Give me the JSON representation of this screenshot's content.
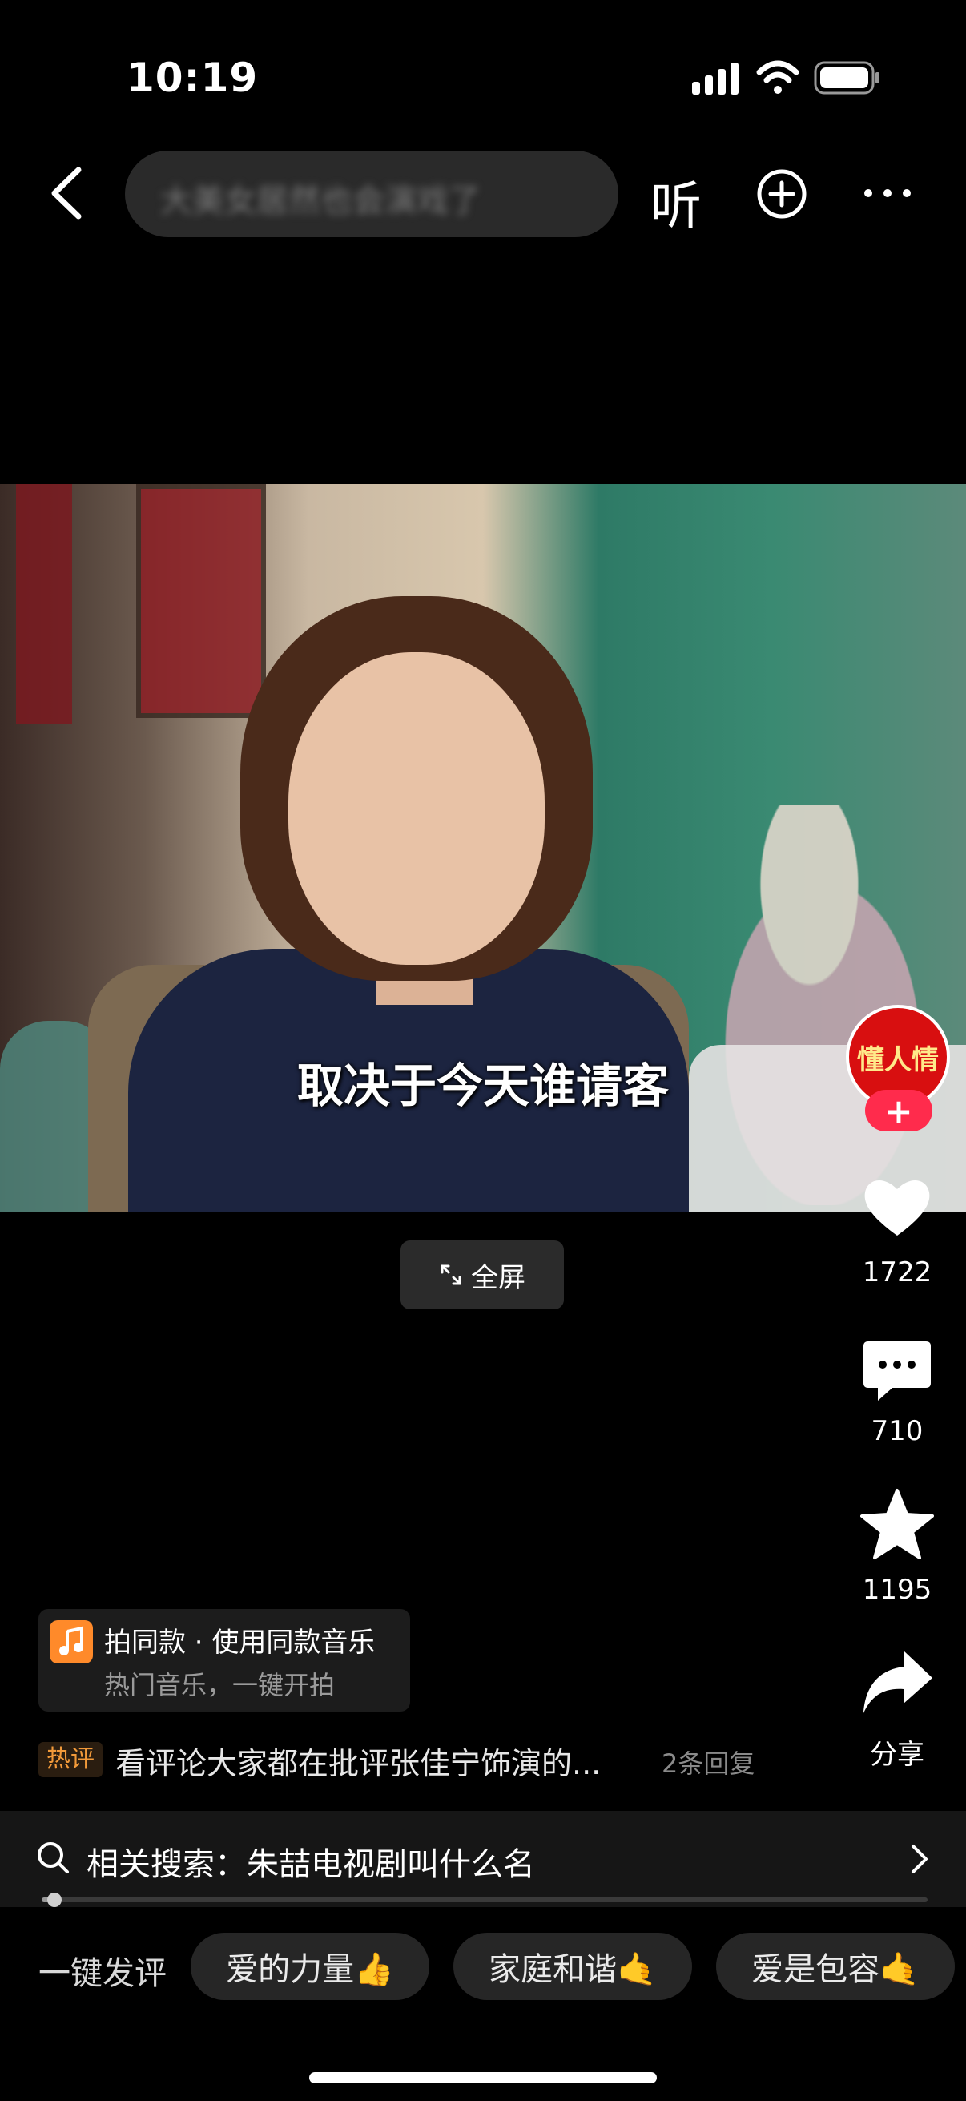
{
  "status_bar": {
    "time": "10:19"
  },
  "top_nav": {
    "search_placeholder": "大美女居然也会演戏了",
    "listen_label": "听"
  },
  "video": {
    "subtitle": "取决于今天谁请客",
    "fullscreen_label": "全屏"
  },
  "creator": {
    "avatar_text": "懂人情",
    "follow_label": "+"
  },
  "actions": {
    "like_count": "1722",
    "comment_count": "710",
    "favorite_count": "1195",
    "share_label": "分享"
  },
  "music_promo": {
    "title": "拍同款 · 使用同款音乐",
    "subtitle": "热门音乐，一键开拍"
  },
  "hot_comment": {
    "badge": "热评",
    "text": "看评论大家都在批评张佳宁饰演的...",
    "replies": "2条回复"
  },
  "related_search": {
    "text": "相关搜索：朱喆电视剧叫什么名",
    "progress": 0.01
  },
  "quick_comment": {
    "label": "一键发评",
    "chips": [
      "爱的力量👍",
      "家庭和谐🤙",
      "爱是包容🤙"
    ]
  }
}
